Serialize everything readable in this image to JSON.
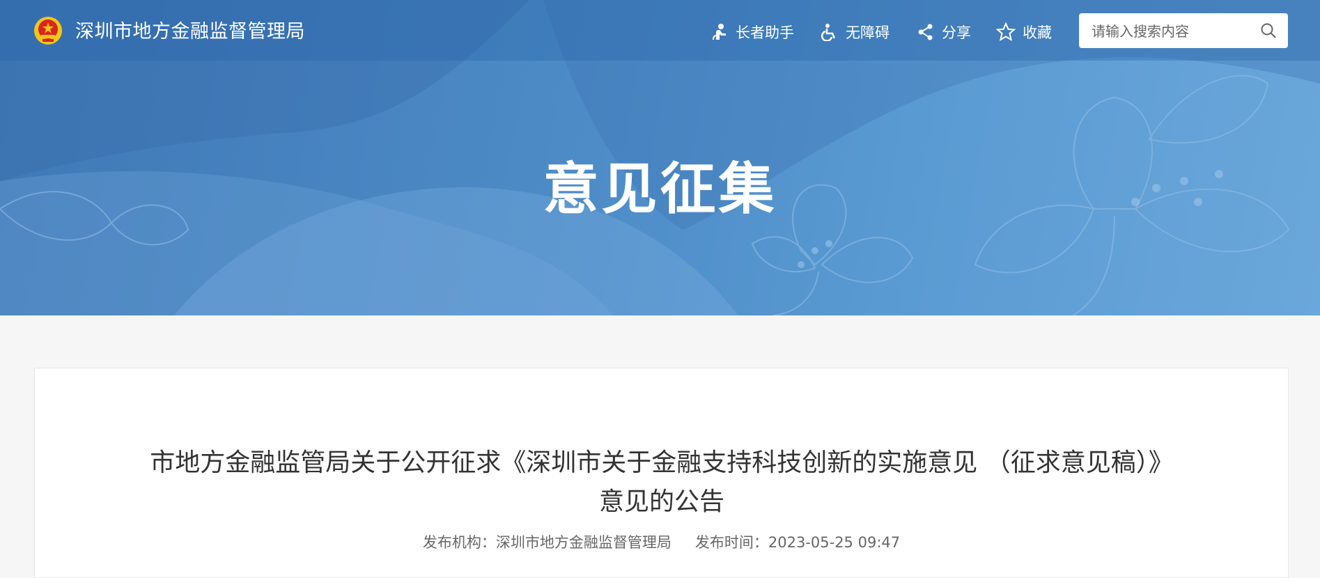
{
  "header": {
    "site_name": "深圳市地方金融监督管理局",
    "toolbar": {
      "elder_label": "长者助手",
      "accessibility_label": "无障碍",
      "share_label": "分享",
      "favorite_label": "收藏"
    },
    "search": {
      "placeholder": "请输入搜索内容"
    }
  },
  "banner": {
    "title": "意见征集"
  },
  "article": {
    "title_line1": "市地方金融监管局关于公开征求《深圳市关于金融支持科技创新的实施意见 （征求意见稿）》",
    "title_line2": "意见的公告",
    "meta": {
      "publisher_label": "发布机构：",
      "publisher_value": "深圳市地方金融监督管理局",
      "time_label": "发布时间：",
      "time_value": "2023-05-25 09:47"
    }
  },
  "colors": {
    "banner_blue": "#4d8cc7",
    "emblem_red": "#d7261e",
    "emblem_gold": "#f5c518",
    "text_dark": "#333333"
  }
}
